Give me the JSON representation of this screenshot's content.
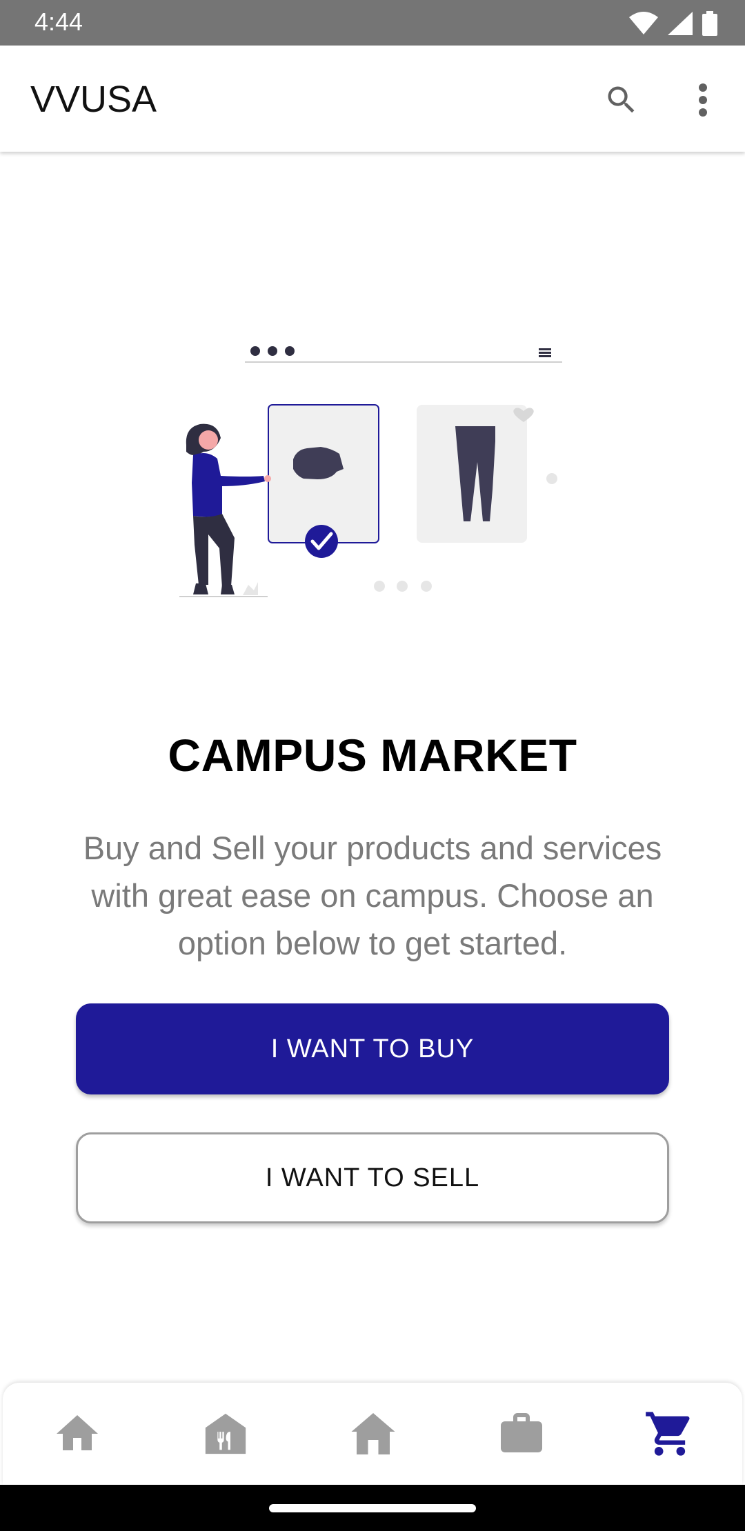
{
  "status_bar": {
    "time": "4:44",
    "icons": [
      "wifi-icon",
      "signal-icon",
      "battery-icon"
    ]
  },
  "app_bar": {
    "title": "VVUSA",
    "icons": [
      "search-icon",
      "more-vert-icon"
    ]
  },
  "main": {
    "title": "CAMPUS MARKET",
    "description": "Buy and Sell your products and services with great ease on campus. Choose an option below to get started.",
    "buy_label": "I WANT TO BUY",
    "sell_label": "I WANT TO SELL"
  },
  "bottom_nav": {
    "items": [
      {
        "icon": "home-icon",
        "active": false
      },
      {
        "icon": "dining-icon",
        "active": false
      },
      {
        "icon": "housing-icon",
        "active": false
      },
      {
        "icon": "briefcase-icon",
        "active": false
      },
      {
        "icon": "cart-icon",
        "active": true
      }
    ]
  },
  "colors": {
    "primary": "#1f1a98",
    "inactive_icon": "#9e9e9e",
    "status_bar": "#757575"
  }
}
